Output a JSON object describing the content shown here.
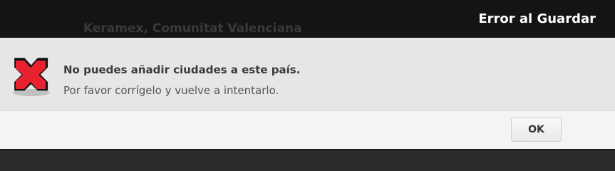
{
  "dialog": {
    "title": "Error al Guardar",
    "background_text": "Keramex, Comunitat Valenciana",
    "icon": "error-x-icon",
    "heading": "No puedes añadir ciudades a este país.",
    "message": "Por favor corrígelo y vuelve a intentarlo.",
    "ok_label": "OK"
  },
  "colors": {
    "titlebar": "#141414",
    "body": "#e6e6e6",
    "footer": "#f4f4f4",
    "error_red": "#e8212e"
  }
}
